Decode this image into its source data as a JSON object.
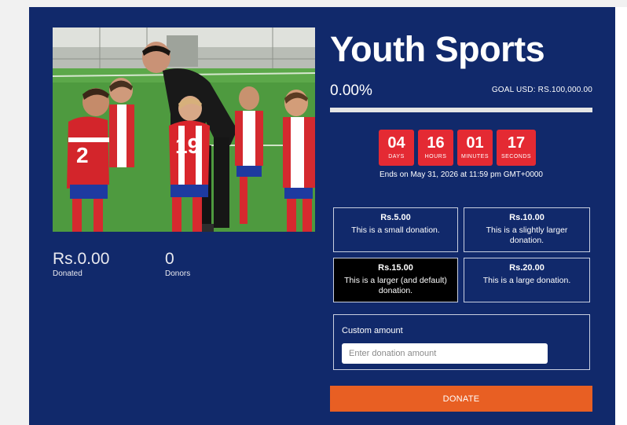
{
  "campaign": {
    "title": "Youth Sports",
    "percent_text": "0.00%",
    "progress_fraction": 0.0,
    "goal_text": "GOAL USD: RS.100,000.00"
  },
  "stats": {
    "donated_value": "Rs.0.00",
    "donated_label": "Donated",
    "donors_value": "0",
    "donors_label": "Donors"
  },
  "countdown": {
    "units": [
      {
        "value": "04",
        "label": "DAYS"
      },
      {
        "value": "16",
        "label": "HOURS"
      },
      {
        "value": "01",
        "label": "MINUTES"
      },
      {
        "value": "17",
        "label": "SECONDS"
      }
    ],
    "ends_text": "Ends on May 31, 2026 at 11:59 pm GMT+0000"
  },
  "tiers": [
    {
      "amount": "Rs.5.00",
      "description": "This is a small donation."
    },
    {
      "amount": "Rs.10.00",
      "description": "This is a slightly larger donation."
    },
    {
      "amount": "Rs.15.00",
      "description": "This is a larger (and default) donation."
    },
    {
      "amount": "Rs.20.00",
      "description": "This is a large donation."
    }
  ],
  "custom": {
    "label": "Custom amount",
    "placeholder": "Enter donation amount",
    "value": ""
  },
  "donate_label": "DONATE",
  "colors": {
    "card_bg": "#11296b",
    "accent": "#e85f23",
    "countdown_bg": "#e42a33",
    "selected_tier_bg": "#000000"
  },
  "photo": {
    "jersey_number": "19",
    "jersey_number_2": "2"
  }
}
